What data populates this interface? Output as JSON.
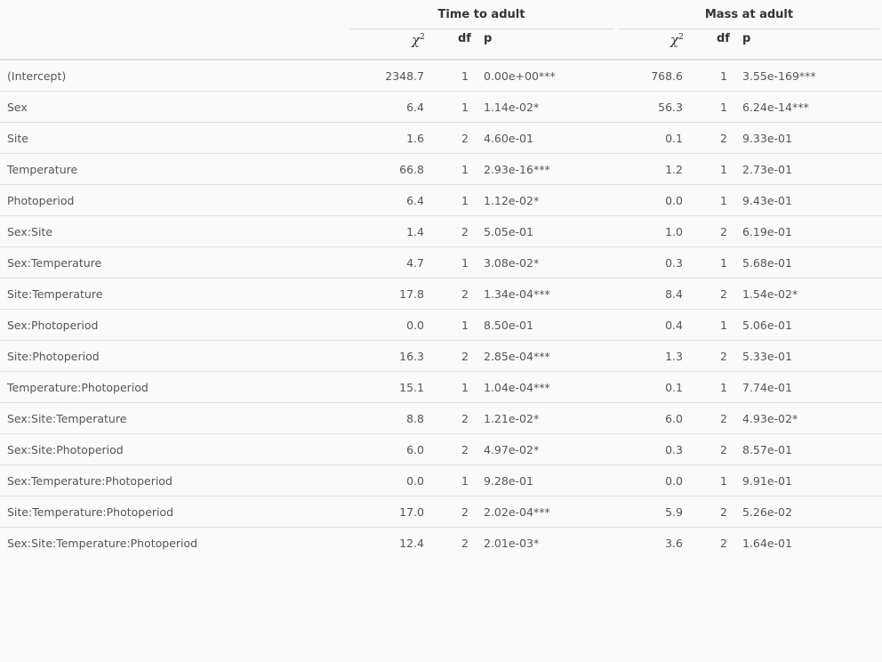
{
  "table": {
    "groups": {
      "time": "Time to adult",
      "mass": "Mass at adult"
    },
    "columns": {
      "chi_base": "χ",
      "chi_sup": "2",
      "df": "df",
      "p": "p"
    },
    "rows": [
      {
        "term": "(Intercept)",
        "t_chi": "2348.7",
        "t_df": "1",
        "t_p": "0.00e+00***",
        "m_chi": "768.6",
        "m_df": "1",
        "m_p": "3.55e-169***"
      },
      {
        "term": "Sex",
        "t_chi": "6.4",
        "t_df": "1",
        "t_p": "1.14e-02*",
        "m_chi": "56.3",
        "m_df": "1",
        "m_p": "6.24e-14***"
      },
      {
        "term": "Site",
        "t_chi": "1.6",
        "t_df": "2",
        "t_p": "4.60e-01",
        "m_chi": "0.1",
        "m_df": "2",
        "m_p": "9.33e-01"
      },
      {
        "term": "Temperature",
        "t_chi": "66.8",
        "t_df": "1",
        "t_p": "2.93e-16***",
        "m_chi": "1.2",
        "m_df": "1",
        "m_p": "2.73e-01"
      },
      {
        "term": "Photoperiod",
        "t_chi": "6.4",
        "t_df": "1",
        "t_p": "1.12e-02*",
        "m_chi": "0.0",
        "m_df": "1",
        "m_p": "9.43e-01"
      },
      {
        "term": "Sex:Site",
        "t_chi": "1.4",
        "t_df": "2",
        "t_p": "5.05e-01",
        "m_chi": "1.0",
        "m_df": "2",
        "m_p": "6.19e-01"
      },
      {
        "term": "Sex:Temperature",
        "t_chi": "4.7",
        "t_df": "1",
        "t_p": "3.08e-02*",
        "m_chi": "0.3",
        "m_df": "1",
        "m_p": "5.68e-01"
      },
      {
        "term": "Site:Temperature",
        "t_chi": "17.8",
        "t_df": "2",
        "t_p": "1.34e-04***",
        "m_chi": "8.4",
        "m_df": "2",
        "m_p": "1.54e-02*"
      },
      {
        "term": "Sex:Photoperiod",
        "t_chi": "0.0",
        "t_df": "1",
        "t_p": "8.50e-01",
        "m_chi": "0.4",
        "m_df": "1",
        "m_p": "5.06e-01"
      },
      {
        "term": "Site:Photoperiod",
        "t_chi": "16.3",
        "t_df": "2",
        "t_p": "2.85e-04***",
        "m_chi": "1.3",
        "m_df": "2",
        "m_p": "5.33e-01"
      },
      {
        "term": "Temperature:Photoperiod",
        "t_chi": "15.1",
        "t_df": "1",
        "t_p": "1.04e-04***",
        "m_chi": "0.1",
        "m_df": "1",
        "m_p": "7.74e-01"
      },
      {
        "term": "Sex:Site:Temperature",
        "t_chi": "8.8",
        "t_df": "2",
        "t_p": "1.21e-02*",
        "m_chi": "6.0",
        "m_df": "2",
        "m_p": "4.93e-02*"
      },
      {
        "term": "Sex:Site:Photoperiod",
        "t_chi": "6.0",
        "t_df": "2",
        "t_p": "4.97e-02*",
        "m_chi": "0.3",
        "m_df": "2",
        "m_p": "8.57e-01"
      },
      {
        "term": "Sex:Temperature:Photoperiod",
        "t_chi": "0.0",
        "t_df": "1",
        "t_p": "9.28e-01",
        "m_chi": "0.0",
        "m_df": "1",
        "m_p": "9.91e-01"
      },
      {
        "term": "Site:Temperature:Photoperiod",
        "t_chi": "17.0",
        "t_df": "2",
        "t_p": "2.02e-04***",
        "m_chi": "5.9",
        "m_df": "2",
        "m_p": "5.26e-02"
      },
      {
        "term": "Sex:Site:Temperature:Photoperiod",
        "t_chi": "12.4",
        "t_df": "2",
        "t_p": "2.01e-03*",
        "m_chi": "3.6",
        "m_df": "2",
        "m_p": "1.64e-01"
      }
    ]
  }
}
